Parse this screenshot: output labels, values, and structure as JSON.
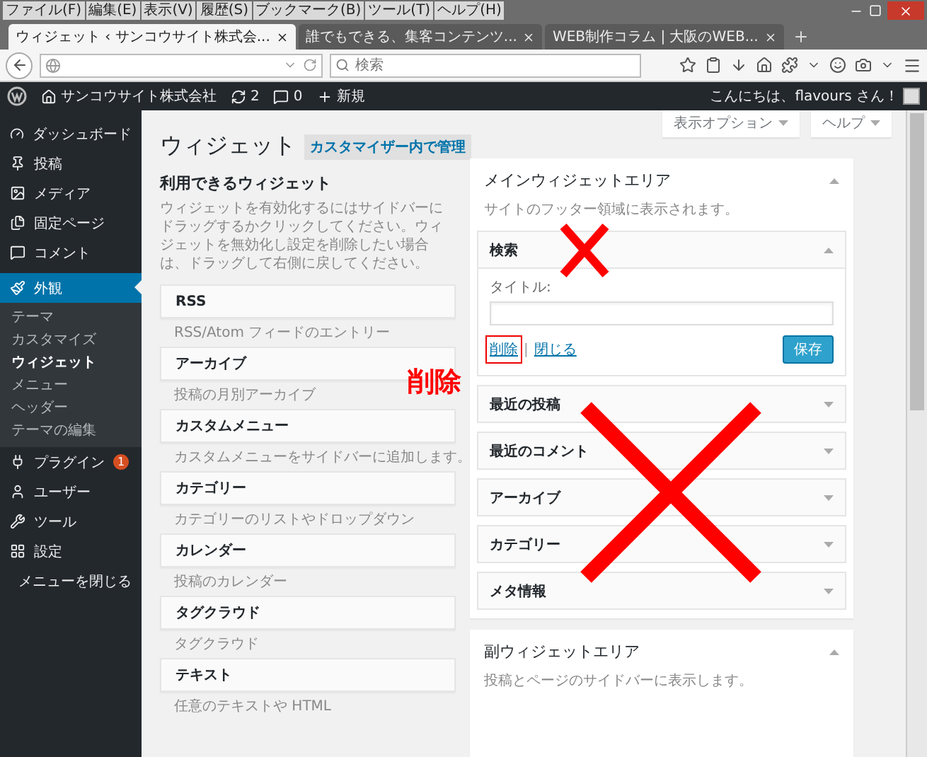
{
  "browser": {
    "menu": [
      "ファイル(F)",
      "編集(E)",
      "表示(V)",
      "履歴(S)",
      "ブックマーク(B)",
      "ツール(T)",
      "ヘルプ(H)"
    ],
    "tabs": [
      {
        "label": "ウィジェット ‹ サンコウサイト株式会...",
        "selected": true
      },
      {
        "label": "誰でもできる、集客コンテンツ...",
        "selected": false
      },
      {
        "label": "WEB制作コラム | 大阪のWEB...",
        "selected": false
      }
    ],
    "search": {
      "placeholder": "検索"
    }
  },
  "admin_bar": {
    "site": "サンコウサイト株式会社",
    "updates": "2",
    "comments": "0",
    "new": "新規",
    "greeting": "こんにちは、flavours さん！"
  },
  "sidebar": {
    "items": [
      {
        "label": "ダッシュボード",
        "selected": false
      },
      {
        "label": "投稿",
        "selected": false
      },
      {
        "label": "メディア",
        "selected": false
      },
      {
        "label": "固定ページ",
        "selected": false
      },
      {
        "label": "コメント",
        "selected": false
      },
      {
        "label": "外観",
        "selected": true,
        "children": [
          {
            "label": "テーマ",
            "selected": false
          },
          {
            "label": "カスタマイズ",
            "selected": false
          },
          {
            "label": "ウィジェット",
            "selected": true
          },
          {
            "label": "メニュー",
            "selected": false
          },
          {
            "label": "ヘッダー",
            "selected": false
          },
          {
            "label": "テーマの編集",
            "selected": false
          }
        ]
      },
      {
        "label": "プラグイン",
        "selected": false,
        "badge": "1"
      },
      {
        "label": "ユーザー",
        "selected": false
      },
      {
        "label": "ツール",
        "selected": false
      },
      {
        "label": "設定",
        "selected": false
      },
      {
        "label": "メニューを閉じる",
        "selected": false
      }
    ]
  },
  "screen_options": [
    "表示オプション",
    "ヘルプ"
  ],
  "page": {
    "title": "ウィジェット",
    "manage_button": "カスタマイザー内で管理"
  },
  "available": {
    "title": "利用できるウィジェット",
    "description": "ウィジェットを有効化するにはサイドバーにドラッグするかクリックしてください。ウィジェットを無効化し設定を削除したい場合は、ドラッグして右側に戻してください。",
    "widgets": [
      {
        "name": "RSS",
        "description": "RSS/Atom フィードのエントリー"
      },
      {
        "name": "アーカイブ",
        "description": "投稿の月別アーカイブ"
      },
      {
        "name": "カスタムメニュー",
        "description": "カスタムメニューをサイドバーに追加します。"
      },
      {
        "name": "カテゴリー",
        "description": "カテゴリーのリストやドロップダウン"
      },
      {
        "name": "カレンダー",
        "description": "投稿のカレンダー"
      },
      {
        "name": "タグクラウド",
        "description": "タグクラウド"
      },
      {
        "name": "テキスト",
        "description": "任意のテキストや HTML"
      }
    ]
  },
  "areas": [
    {
      "title": "メインウィジェットエリア",
      "description": "サイトのフッター領域に表示されます。",
      "expanded": true,
      "widgets": [
        {
          "name": "検索",
          "expanded": true,
          "field_label": "タイトル:",
          "delete": "削除",
          "separator": "|",
          "close": "閉じる",
          "save": "保存"
        },
        {
          "name": "最近の投稿",
          "expanded": false
        },
        {
          "name": "最近のコメント",
          "expanded": false
        },
        {
          "name": "アーカイブ",
          "expanded": false
        },
        {
          "name": "カテゴリー",
          "expanded": false
        },
        {
          "name": "メタ情報",
          "expanded": false
        }
      ]
    },
    {
      "title": "副ウィジェットエリア",
      "description": "投稿とページのサイドバーに表示します。",
      "expanded": true
    }
  ],
  "annotation": {
    "label": "削除"
  }
}
